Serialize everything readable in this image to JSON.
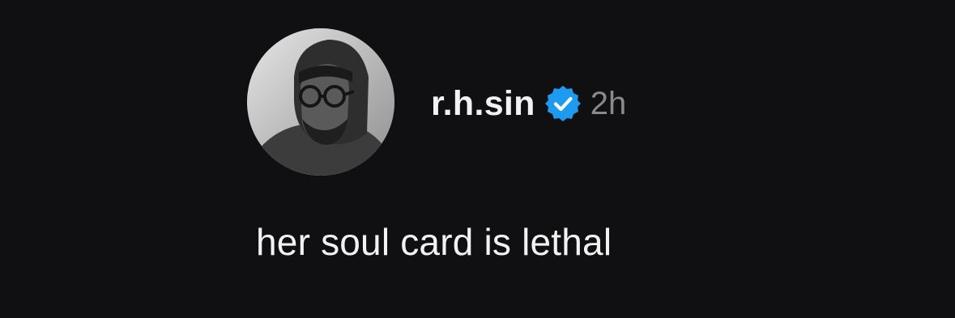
{
  "post": {
    "author": {
      "username": "r.h.sin",
      "verified_icon": "verified-badge-icon",
      "avatar": "profile-photo"
    },
    "timestamp": "2h",
    "text": "her soul card is lethal"
  },
  "colors": {
    "background": "#101012",
    "primary_text": "#f2f2f2",
    "secondary_text": "#8a8a8d",
    "verified_blue": "#1d9bf0"
  }
}
